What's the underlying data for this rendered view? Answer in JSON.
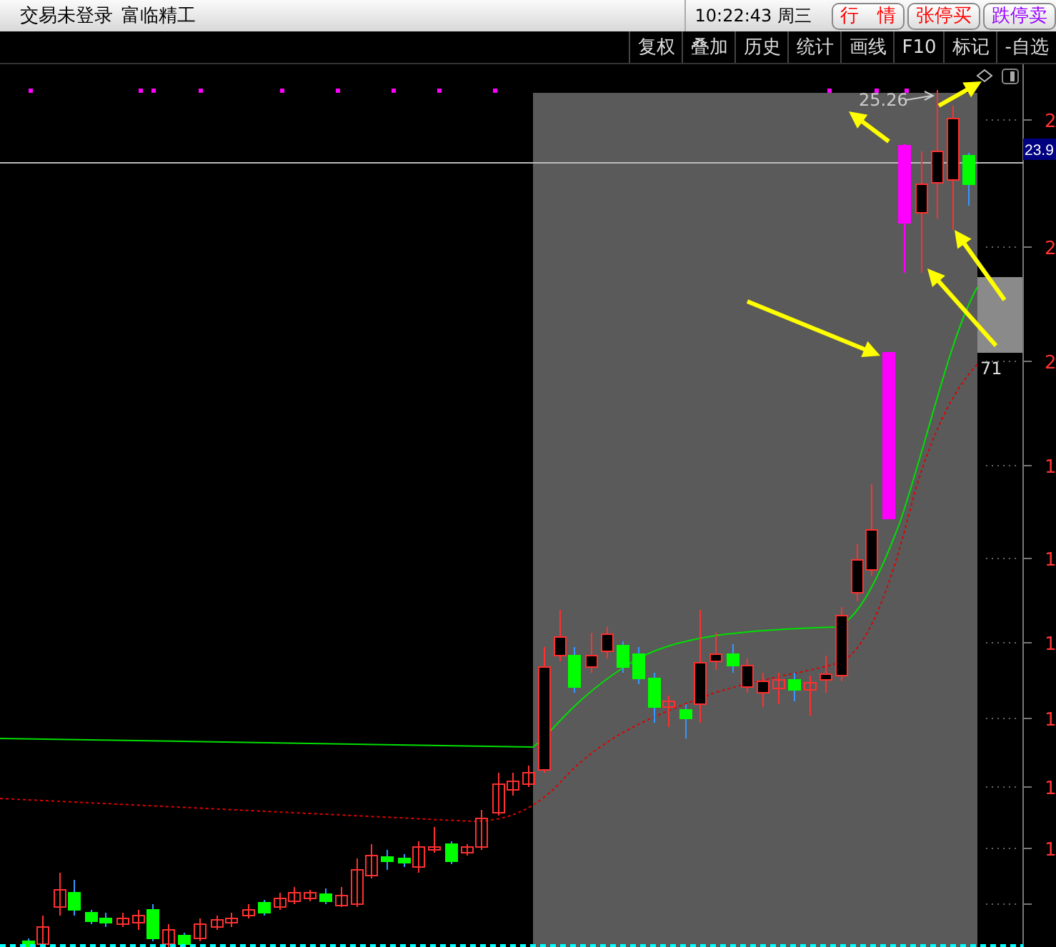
{
  "title_bar": {
    "status": "交易未登录",
    "stock_name": "富临精工",
    "clock": "10:22:43 周三",
    "quick_buttons": [
      {
        "label": "行　情",
        "color": "#ff0000"
      },
      {
        "label": "张停买",
        "color": "#ff0000"
      },
      {
        "label": "跌停卖",
        "color": "#9900ff"
      }
    ]
  },
  "toolbar": {
    "items": [
      "复权",
      "叠加",
      "历史",
      "统计",
      "画线",
      "F10",
      "标记",
      "-自选"
    ]
  },
  "chart": {
    "price_axis_labels": [
      "2",
      "2",
      "2",
      "1",
      "1",
      "1",
      "1",
      "1",
      "1"
    ],
    "current_price": "23.9",
    "high_marker": "25.26",
    "box_label": "71"
  }
}
